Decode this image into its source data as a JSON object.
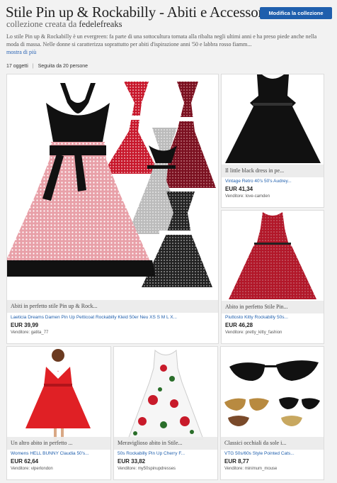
{
  "header": {
    "title": "Stile Pin up & Rockabilly - Abiti e Accessori",
    "subtitle_prefix": "collezione creata da",
    "author": "fedelefreaks",
    "edit_button": "Modifica la collezione",
    "description": "Lo stile Pin up & Rockabilly è un evergreen: fa parte di una sottocultura tornata alla ribalta negli ultimi anni e ha preso piede anche nella moda di massa. Nelle donne si caratterizza soprattutto per abiti d'ispirazione anni '50 e labbra rosso fiamm...",
    "more_link": "mostra di più",
    "items_count": "17 oggetti",
    "followers": "Seguita da 20 persone"
  },
  "items": [
    {
      "caption": "Abiti in perfetto stile Pin up & Rock...",
      "title": "Laeticia Dreams Damen Pin Up Petticoat Rockabilly Kleid 50er Neu XS S M L X...",
      "price": "EUR 39,99",
      "seller": "Venditore: gatita_77"
    },
    {
      "caption": "Il little black dress in pe...",
      "title": "Vintage Retro 40's 50's Audrey...",
      "price": "EUR 41,34",
      "seller": "Venditore: love-camden"
    },
    {
      "caption": "Abito in perfetto Stile Pin...",
      "title": "Piuttosto Kitty Rockabilly 50s...",
      "price": "EUR 46,28",
      "seller": "Venditore: pretty_kitty_fashion"
    },
    {
      "caption": "Un altro abito in perfetto ...",
      "title": "Womens HELL BUNNY Claudia 50's...",
      "price": "EUR 62,64",
      "seller": "Venditore: viperlondon"
    },
    {
      "caption": "Meraviglioso abito in Stile...",
      "title": "50s Rockabilly Pin Up Cherry F...",
      "price": "EUR 33,82",
      "seller": "Venditore: my50spinupdresses"
    },
    {
      "caption": "Classici occhiali da sole i...",
      "title": "VTG 50s/60s Style Pointed Cats...",
      "price": "EUR 8,77",
      "seller": "Venditore: minimum_mouse"
    }
  ],
  "colors": {
    "accent": "#1f5fad",
    "link": "#2a64b5",
    "background": "#f2f2f2"
  }
}
